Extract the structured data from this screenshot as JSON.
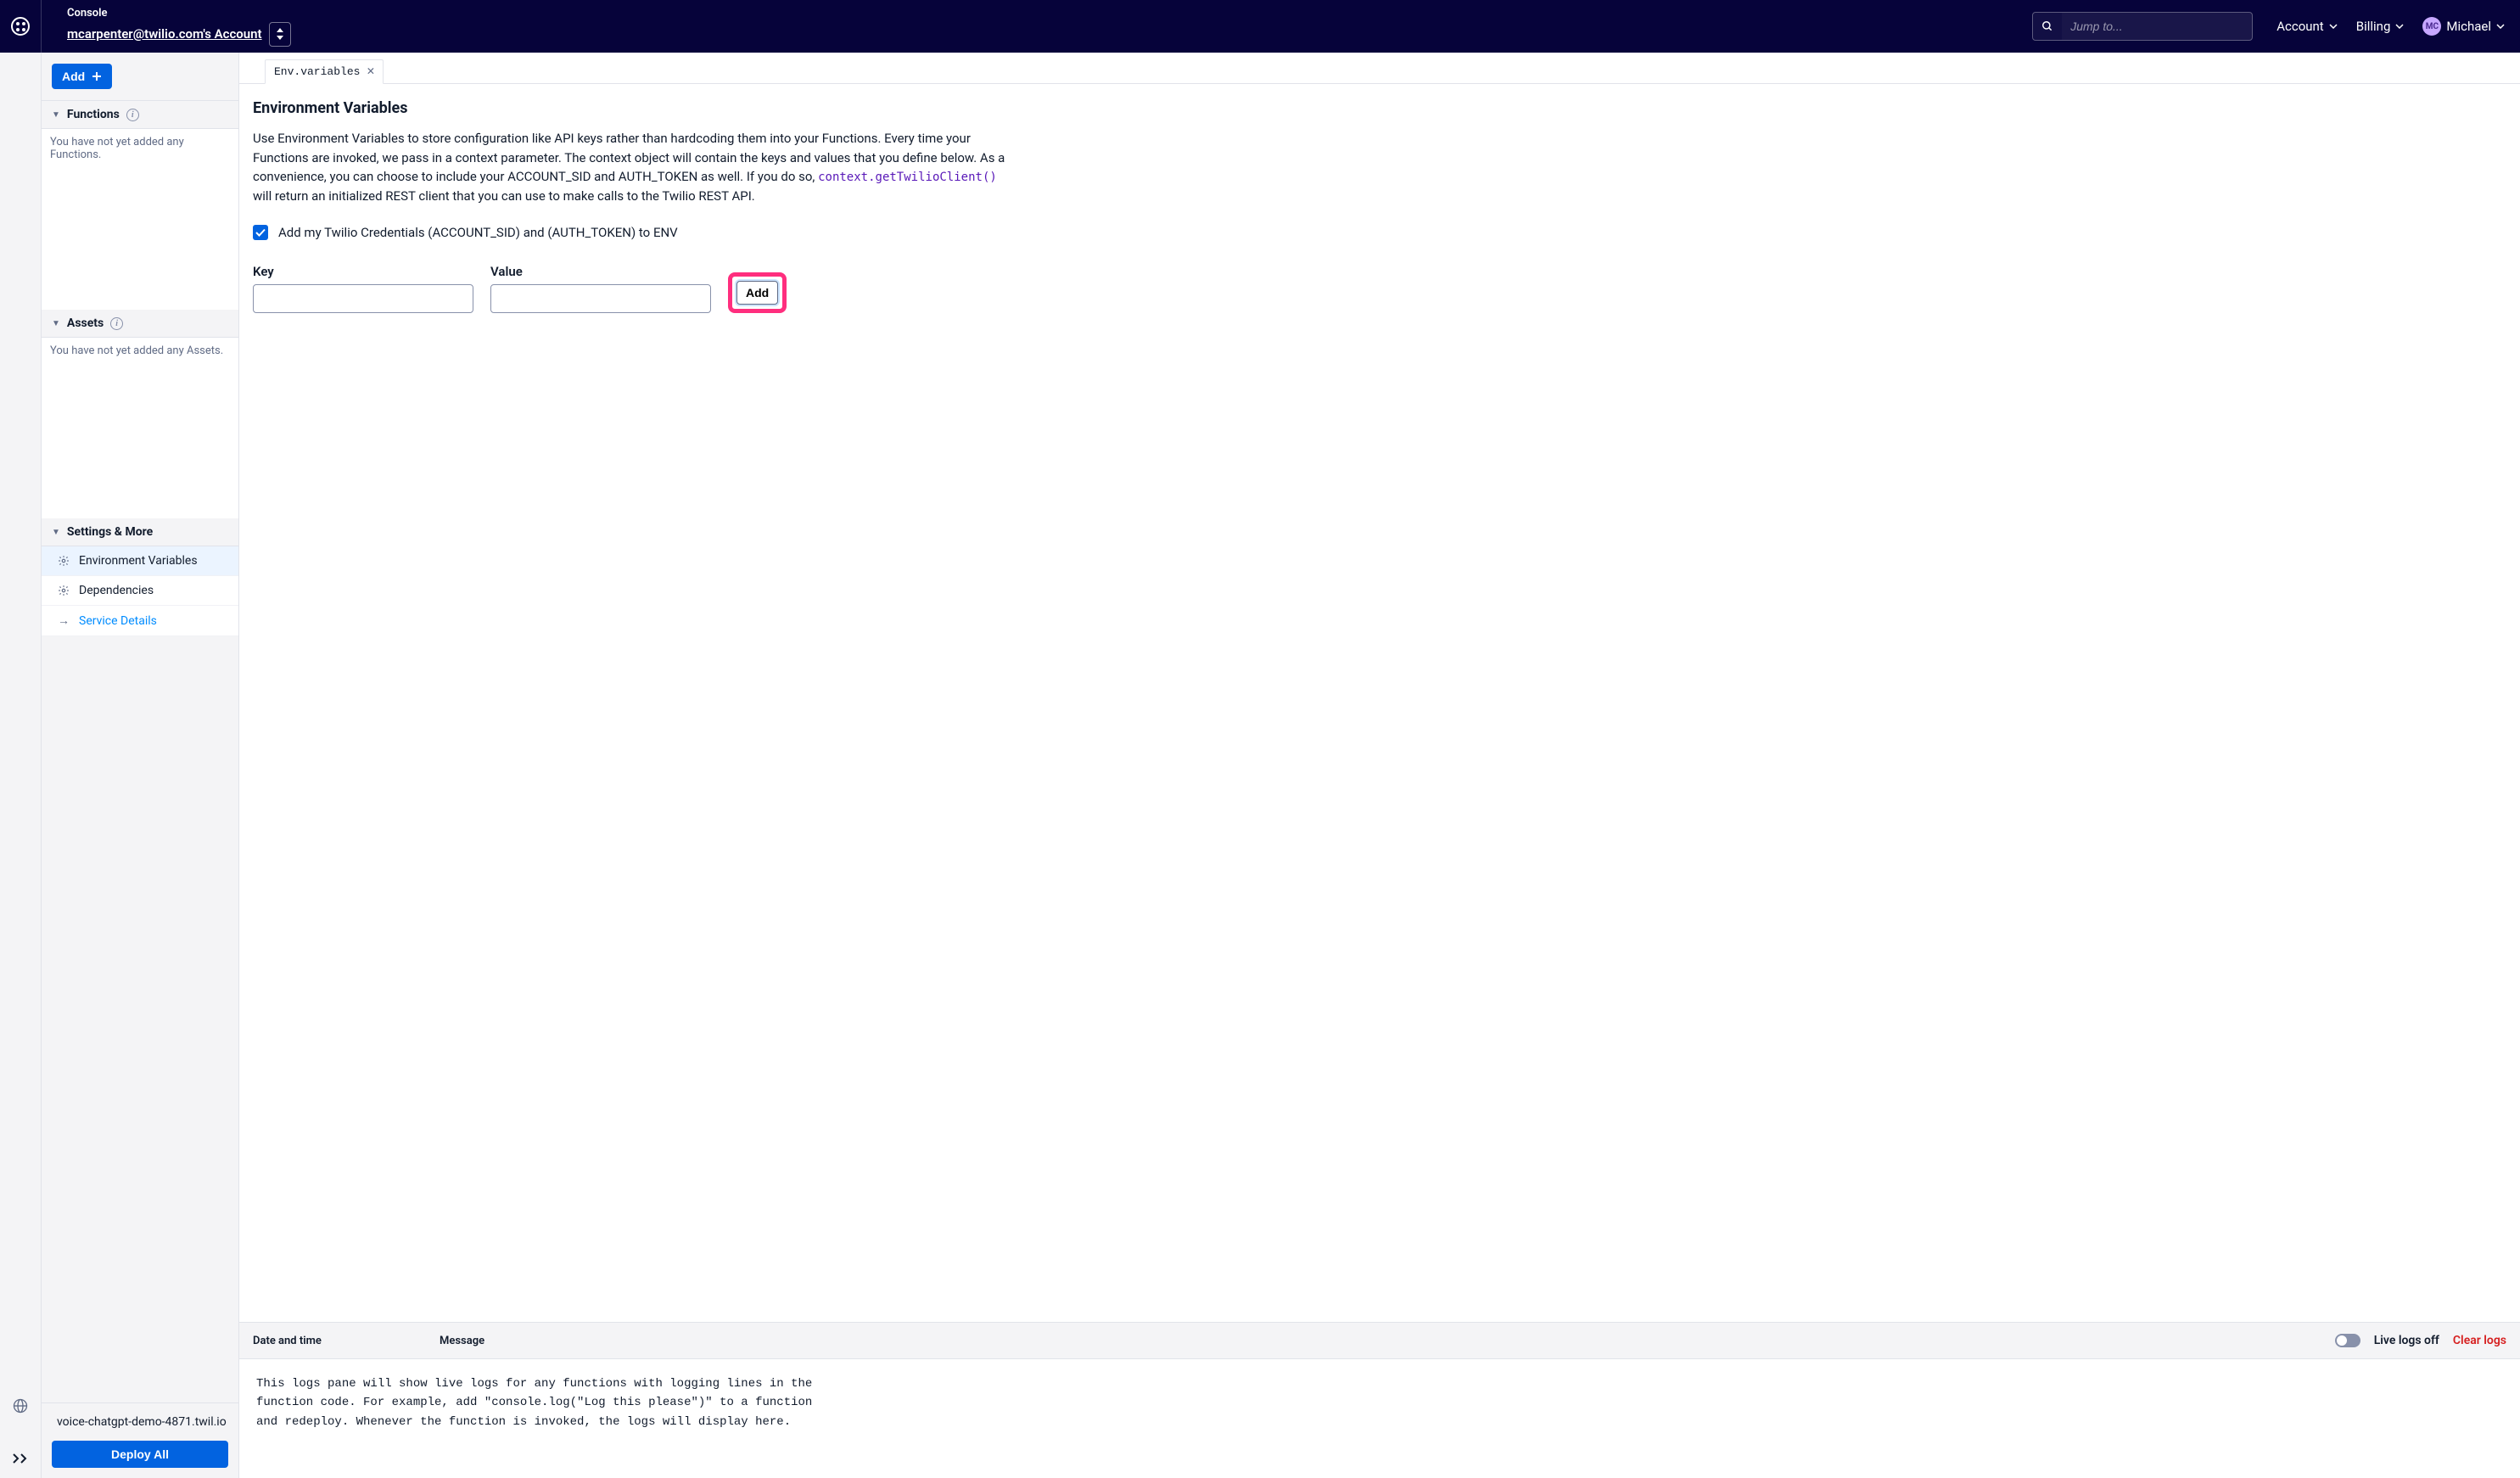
{
  "header": {
    "console_label": "Console",
    "account_name": "mcarpenter@twilio.com's Account",
    "search_placeholder": "Jump to...",
    "nav_account": "Account",
    "nav_billing": "Billing",
    "user_initials": "MC",
    "user_name": "Michael"
  },
  "sidebar": {
    "add_button": "Add",
    "section_functions": "Functions",
    "section_assets": "Assets",
    "section_settings": "Settings & More",
    "functions_empty": "You have not yet added any Functions.",
    "assets_empty": "You have not yet added any Assets.",
    "settings_items": {
      "env": "Environment Variables",
      "deps": "Dependencies",
      "details": "Service Details"
    },
    "domain": "voice-chatgpt-demo-4871.twil.io",
    "deploy_button": "Deploy All"
  },
  "tabs": {
    "env_label": "Env.variables"
  },
  "content": {
    "title": "Environment Variables",
    "description_pre": "Use Environment Variables to store configuration like API keys rather than hardcoding them into your Functions. Every time your Functions are invoked, we pass in a context parameter. The context object will contain the keys and values that you define below. As a convenience, you can choose to include your ACCOUNT_SID and AUTH_TOKEN as well. If you do so, ",
    "description_code": "context.getTwilioClient()",
    "description_post": " will return an initialized REST client that you can use to make calls to the Twilio REST API.",
    "credentials_label": "Add my Twilio Credentials (ACCOUNT_SID) and (AUTH_TOKEN) to ENV",
    "key_label": "Key",
    "value_label": "Value",
    "key_value": "",
    "value_value": "",
    "add_button": "Add"
  },
  "logs": {
    "col_datetime": "Date and time",
    "col_message": "Message",
    "live_label": "Live logs off",
    "clear_label": "Clear logs",
    "body": "This logs pane will show live logs for any functions with logging lines in the\nfunction code. For example, add \"console.log(\"Log this please\")\" to a function\nand redeploy. Whenever the function is invoked, the logs will display here."
  }
}
